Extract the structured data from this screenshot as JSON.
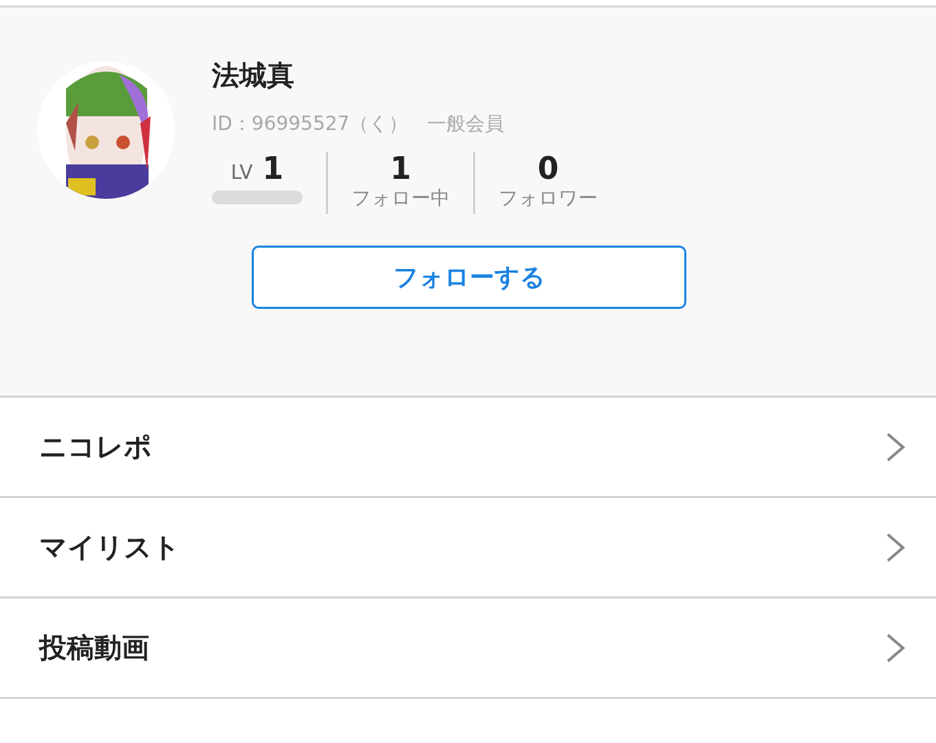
{
  "profile": {
    "name": "法城真",
    "id_line": "ID：96995527（く）　一般会員",
    "level_label": "LV",
    "level_value": "1",
    "level": 0,
    "stats": [
      {
        "value": "1",
        "label": "フォロー中"
      },
      {
        "value": "0",
        "label": "フォロワー"
      }
    ],
    "follow_button": "フォローする"
  },
  "menu": [
    {
      "label": "ニコレポ"
    },
    {
      "label": "マイリスト"
    },
    {
      "label": "投稿動画"
    }
  ]
}
